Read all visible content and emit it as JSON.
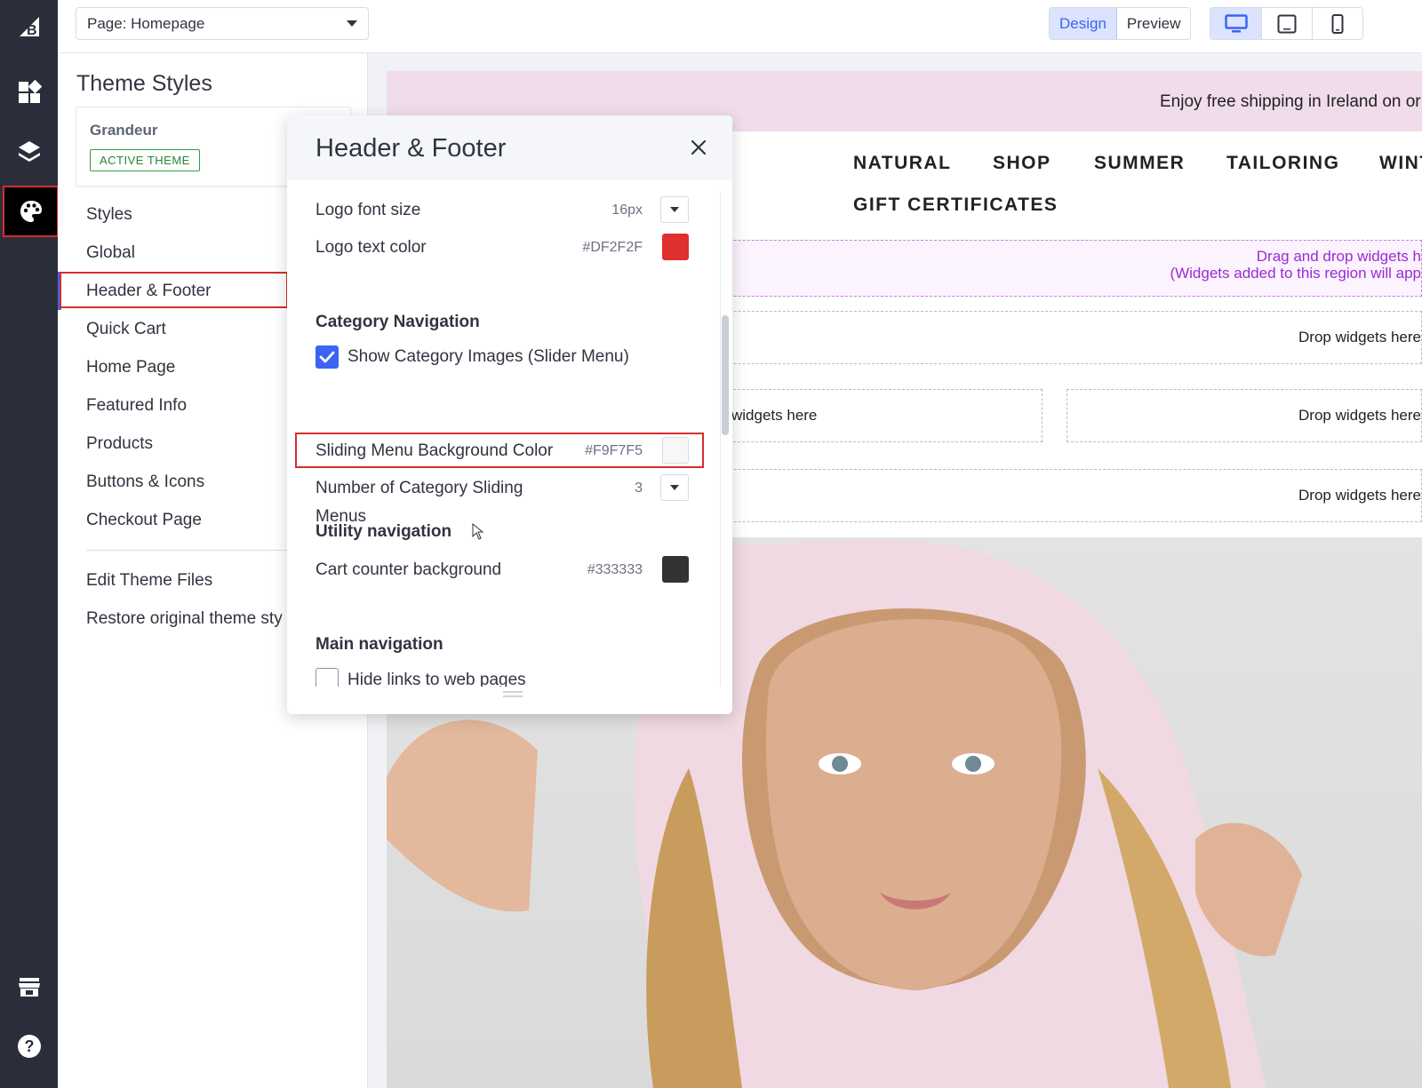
{
  "topbar": {
    "page_select": "Page: Homepage",
    "mode_design": "Design",
    "mode_preview": "Preview"
  },
  "rail": {
    "icons": [
      "bigcommerce-logo-icon",
      "dashboard-icon",
      "layers-icon",
      "palette-icon",
      "storefront-icon",
      "help-icon"
    ]
  },
  "panel": {
    "title": "Theme Styles",
    "theme_name": "Grandeur",
    "active_badge": "ACTIVE THEME",
    "items": [
      {
        "label": "Styles"
      },
      {
        "label": "Global"
      },
      {
        "label": "Header & Footer"
      },
      {
        "label": "Quick Cart"
      },
      {
        "label": "Home Page"
      },
      {
        "label": "Featured Info"
      },
      {
        "label": "Products"
      },
      {
        "label": "Buttons & Icons"
      },
      {
        "label": "Checkout Page"
      }
    ],
    "edit_files": "Edit Theme Files",
    "restore": "Restore original theme sty"
  },
  "modal": {
    "title": "Header & Footer",
    "logo_font_size_label": "Logo font size",
    "logo_font_size_value": "16px",
    "logo_text_color_label": "Logo text color",
    "logo_text_color_value": "#DF2F2F",
    "category_nav_heading": "Category Navigation",
    "show_category_images_label": "Show Category Images (Slider Menu)",
    "show_category_images_checked": true,
    "sliding_bg_label": "Sliding Menu Background Color",
    "sliding_bg_value": "#F9F7F5",
    "num_sliding_label_1": "Number of Category Sliding",
    "num_sliding_label_2": "Menus",
    "num_sliding_value": "3",
    "utility_nav_heading": "Utility navigation",
    "cart_counter_label": "Cart counter background",
    "cart_counter_value": "#333333",
    "main_nav_heading": "Main navigation",
    "hide_links_label": "Hide links to web pages",
    "hide_links_checked": false
  },
  "preview": {
    "promo_text": "Enjoy free shipping in Ireland on or",
    "menu_row1": [
      "NATURAL",
      "SHOP",
      "SUMMER",
      "TAILORING",
      "WINT"
    ],
    "menu_row2": [
      "GIFT CERTIFICATES"
    ],
    "drag_line1": "Drag and drop widgets h",
    "drag_line2": "(Widgets added to this region will app",
    "drop_text": "Drop widgets here",
    "drop_text_partial": "widgets here"
  },
  "colors": {
    "accent": "#3C64F4",
    "highlight": "#D32F2F",
    "rail": "#2B2E3A",
    "active_badge": "#208831",
    "promo_bg": "#F1DCEC"
  }
}
